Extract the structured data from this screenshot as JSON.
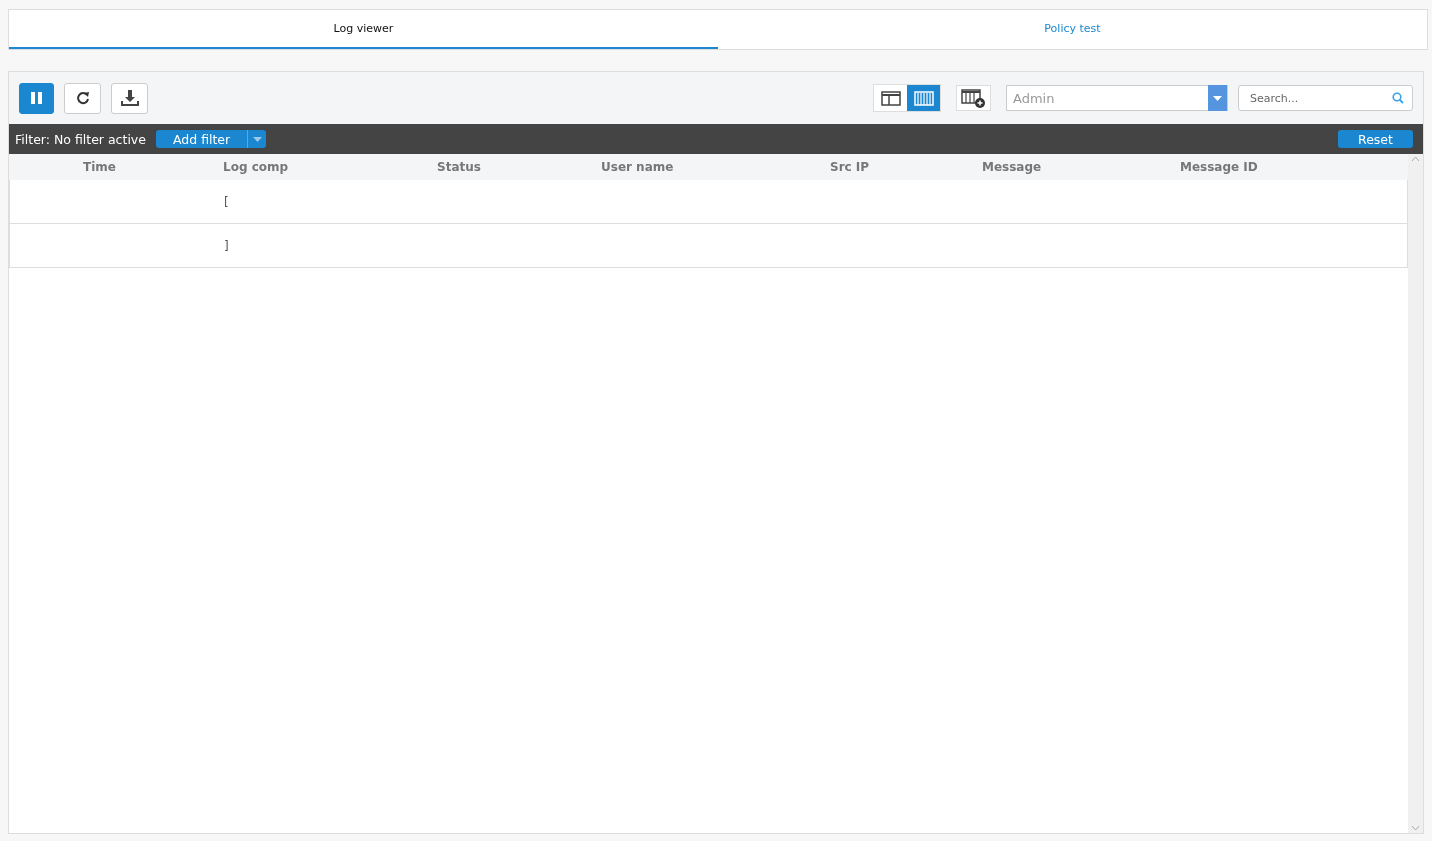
{
  "tabs": [
    {
      "label": "Log viewer",
      "selected": true
    },
    {
      "label": "Policy test",
      "selected": false
    }
  ],
  "toolbar": {
    "paused": true,
    "view_modes": [
      {
        "kind": "split",
        "selected": false
      },
      {
        "kind": "columns",
        "selected": true
      }
    ],
    "log_select": {
      "value": "Admin"
    },
    "search": {
      "placeholder": "Search..."
    }
  },
  "filter_bar": {
    "label": "Filter: No filter active",
    "add_filter": "Add filter",
    "reset": "Reset"
  },
  "table": {
    "columns": [
      "Time",
      "Log comp",
      "Status",
      "User name",
      "Src IP",
      "Message",
      "Message ID"
    ],
    "rows": [
      [
        "",
        "[",
        "",
        "",
        "",
        "",
        ""
      ],
      [
        "",
        "]",
        "",
        "",
        "",
        "",
        ""
      ]
    ]
  }
}
